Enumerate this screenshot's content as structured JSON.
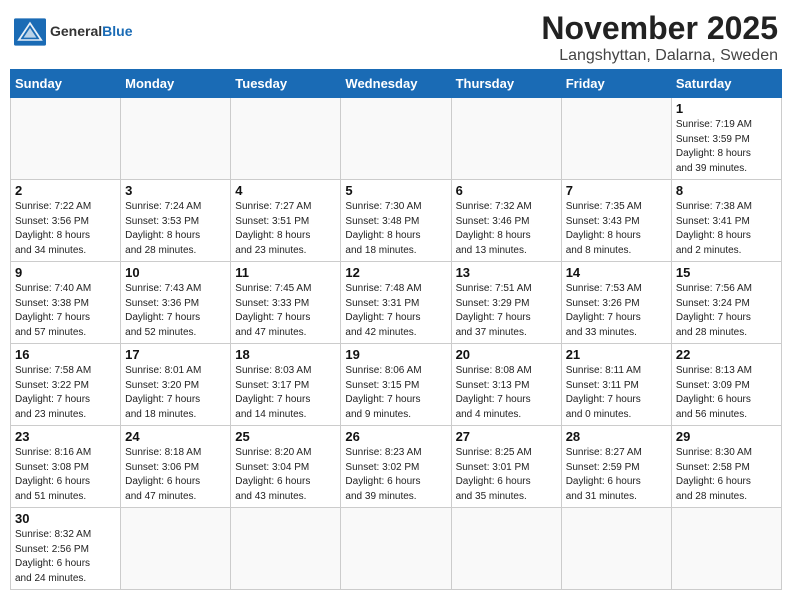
{
  "header": {
    "logo_text_general": "General",
    "logo_text_blue": "Blue",
    "month": "November 2025",
    "location": "Langshyttan, Dalarna, Sweden"
  },
  "days_of_week": [
    "Sunday",
    "Monday",
    "Tuesday",
    "Wednesday",
    "Thursday",
    "Friday",
    "Saturday"
  ],
  "weeks": [
    [
      {
        "day": "",
        "info": ""
      },
      {
        "day": "",
        "info": ""
      },
      {
        "day": "",
        "info": ""
      },
      {
        "day": "",
        "info": ""
      },
      {
        "day": "",
        "info": ""
      },
      {
        "day": "",
        "info": ""
      },
      {
        "day": "1",
        "info": "Sunrise: 7:19 AM\nSunset: 3:59 PM\nDaylight: 8 hours\nand 39 minutes."
      }
    ],
    [
      {
        "day": "2",
        "info": "Sunrise: 7:22 AM\nSunset: 3:56 PM\nDaylight: 8 hours\nand 34 minutes."
      },
      {
        "day": "3",
        "info": "Sunrise: 7:24 AM\nSunset: 3:53 PM\nDaylight: 8 hours\nand 28 minutes."
      },
      {
        "day": "4",
        "info": "Sunrise: 7:27 AM\nSunset: 3:51 PM\nDaylight: 8 hours\nand 23 minutes."
      },
      {
        "day": "5",
        "info": "Sunrise: 7:30 AM\nSunset: 3:48 PM\nDaylight: 8 hours\nand 18 minutes."
      },
      {
        "day": "6",
        "info": "Sunrise: 7:32 AM\nSunset: 3:46 PM\nDaylight: 8 hours\nand 13 minutes."
      },
      {
        "day": "7",
        "info": "Sunrise: 7:35 AM\nSunset: 3:43 PM\nDaylight: 8 hours\nand 8 minutes."
      },
      {
        "day": "8",
        "info": "Sunrise: 7:38 AM\nSunset: 3:41 PM\nDaylight: 8 hours\nand 2 minutes."
      }
    ],
    [
      {
        "day": "9",
        "info": "Sunrise: 7:40 AM\nSunset: 3:38 PM\nDaylight: 7 hours\nand 57 minutes."
      },
      {
        "day": "10",
        "info": "Sunrise: 7:43 AM\nSunset: 3:36 PM\nDaylight: 7 hours\nand 52 minutes."
      },
      {
        "day": "11",
        "info": "Sunrise: 7:45 AM\nSunset: 3:33 PM\nDaylight: 7 hours\nand 47 minutes."
      },
      {
        "day": "12",
        "info": "Sunrise: 7:48 AM\nSunset: 3:31 PM\nDaylight: 7 hours\nand 42 minutes."
      },
      {
        "day": "13",
        "info": "Sunrise: 7:51 AM\nSunset: 3:29 PM\nDaylight: 7 hours\nand 37 minutes."
      },
      {
        "day": "14",
        "info": "Sunrise: 7:53 AM\nSunset: 3:26 PM\nDaylight: 7 hours\nand 33 minutes."
      },
      {
        "day": "15",
        "info": "Sunrise: 7:56 AM\nSunset: 3:24 PM\nDaylight: 7 hours\nand 28 minutes."
      }
    ],
    [
      {
        "day": "16",
        "info": "Sunrise: 7:58 AM\nSunset: 3:22 PM\nDaylight: 7 hours\nand 23 minutes."
      },
      {
        "day": "17",
        "info": "Sunrise: 8:01 AM\nSunset: 3:20 PM\nDaylight: 7 hours\nand 18 minutes."
      },
      {
        "day": "18",
        "info": "Sunrise: 8:03 AM\nSunset: 3:17 PM\nDaylight: 7 hours\nand 14 minutes."
      },
      {
        "day": "19",
        "info": "Sunrise: 8:06 AM\nSunset: 3:15 PM\nDaylight: 7 hours\nand 9 minutes."
      },
      {
        "day": "20",
        "info": "Sunrise: 8:08 AM\nSunset: 3:13 PM\nDaylight: 7 hours\nand 4 minutes."
      },
      {
        "day": "21",
        "info": "Sunrise: 8:11 AM\nSunset: 3:11 PM\nDaylight: 7 hours\nand 0 minutes."
      },
      {
        "day": "22",
        "info": "Sunrise: 8:13 AM\nSunset: 3:09 PM\nDaylight: 6 hours\nand 56 minutes."
      }
    ],
    [
      {
        "day": "23",
        "info": "Sunrise: 8:16 AM\nSunset: 3:08 PM\nDaylight: 6 hours\nand 51 minutes."
      },
      {
        "day": "24",
        "info": "Sunrise: 8:18 AM\nSunset: 3:06 PM\nDaylight: 6 hours\nand 47 minutes."
      },
      {
        "day": "25",
        "info": "Sunrise: 8:20 AM\nSunset: 3:04 PM\nDaylight: 6 hours\nand 43 minutes."
      },
      {
        "day": "26",
        "info": "Sunrise: 8:23 AM\nSunset: 3:02 PM\nDaylight: 6 hours\nand 39 minutes."
      },
      {
        "day": "27",
        "info": "Sunrise: 8:25 AM\nSunset: 3:01 PM\nDaylight: 6 hours\nand 35 minutes."
      },
      {
        "day": "28",
        "info": "Sunrise: 8:27 AM\nSunset: 2:59 PM\nDaylight: 6 hours\nand 31 minutes."
      },
      {
        "day": "29",
        "info": "Sunrise: 8:30 AM\nSunset: 2:58 PM\nDaylight: 6 hours\nand 28 minutes."
      }
    ],
    [
      {
        "day": "30",
        "info": "Sunrise: 8:32 AM\nSunset: 2:56 PM\nDaylight: 6 hours\nand 24 minutes."
      },
      {
        "day": "",
        "info": ""
      },
      {
        "day": "",
        "info": ""
      },
      {
        "day": "",
        "info": ""
      },
      {
        "day": "",
        "info": ""
      },
      {
        "day": "",
        "info": ""
      },
      {
        "day": "",
        "info": ""
      }
    ]
  ]
}
